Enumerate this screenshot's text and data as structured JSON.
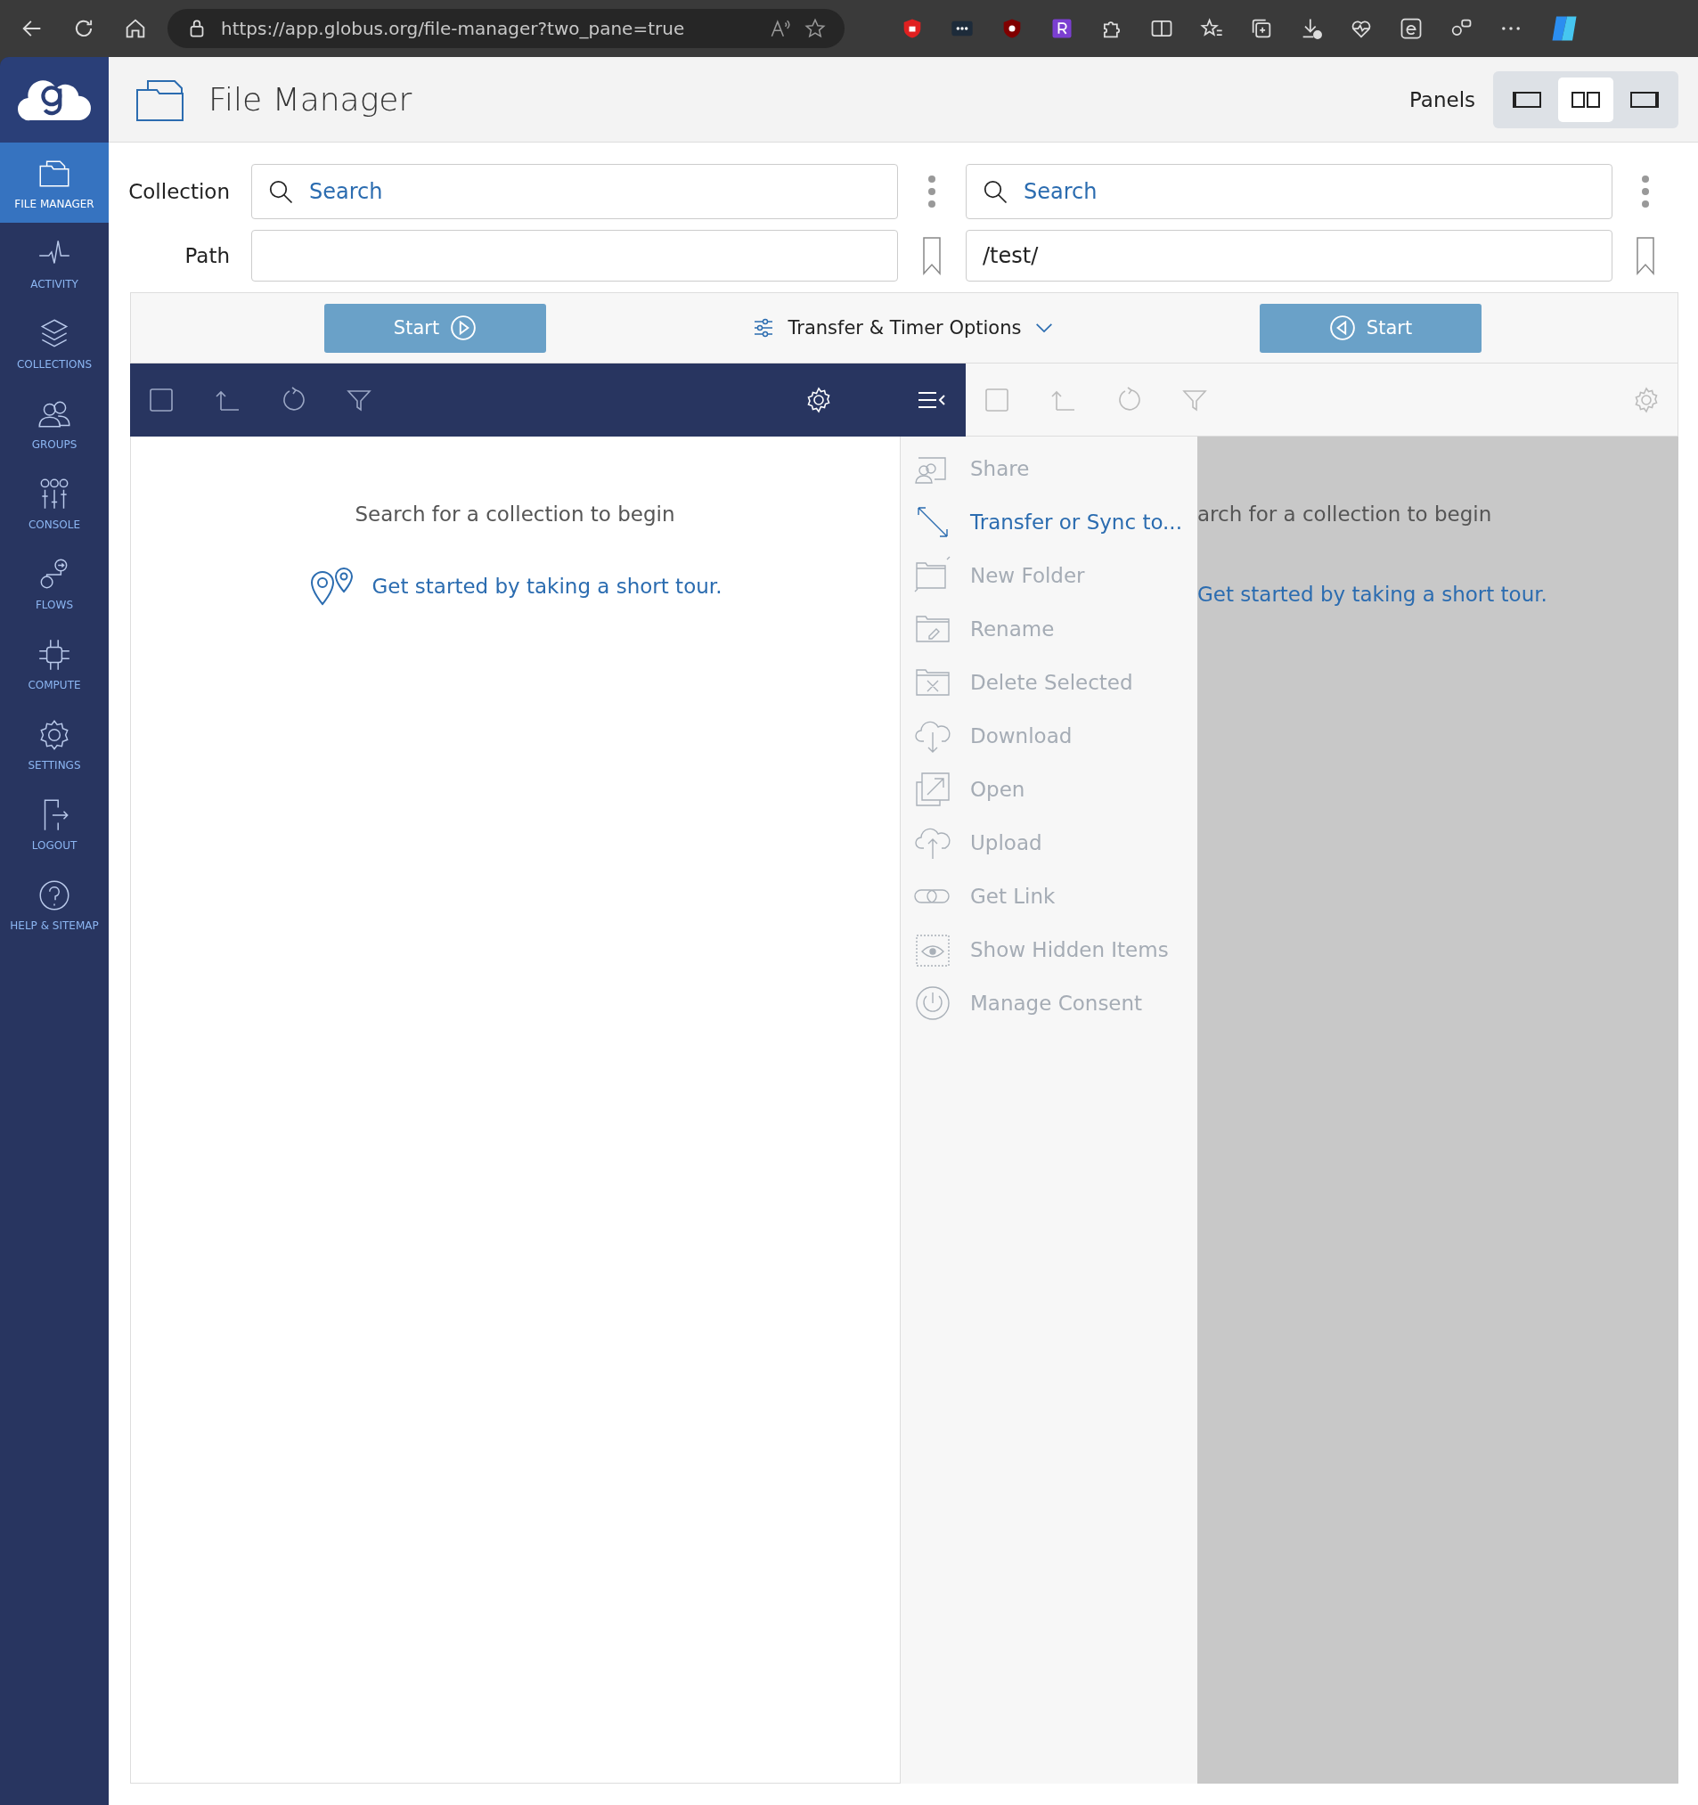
{
  "browser": {
    "url": "https://app.globus.org/file-manager?two_pane=true"
  },
  "sidebar": {
    "items": [
      {
        "label": "FILE MANAGER",
        "kind": "files",
        "selected": true
      },
      {
        "label": "ACTIVITY",
        "kind": "activity",
        "selected": false
      },
      {
        "label": "COLLECTIONS",
        "kind": "layers",
        "selected": false
      },
      {
        "label": "GROUPS",
        "kind": "people",
        "selected": false
      },
      {
        "label": "CONSOLE",
        "kind": "sliders",
        "selected": false
      },
      {
        "label": "FLOWS",
        "kind": "flow",
        "selected": false
      },
      {
        "label": "COMPUTE",
        "kind": "chip",
        "selected": false
      },
      {
        "label": "SETTINGS",
        "kind": "gear",
        "selected": false
      },
      {
        "label": "LOGOUT",
        "kind": "logout",
        "selected": false
      },
      {
        "label": "HELP & SITEMAP",
        "kind": "help",
        "selected": false
      }
    ]
  },
  "header": {
    "title": "File Manager",
    "panels_label": "Panels",
    "panel_options": [
      {
        "kind": "left",
        "selected": false
      },
      {
        "kind": "both",
        "selected": true
      },
      {
        "kind": "right",
        "selected": false
      }
    ]
  },
  "form": {
    "collection_label": "Collection",
    "path_label": "Path",
    "left": {
      "search_placeholder": "Search"
    },
    "right": {
      "search_placeholder": "Search",
      "path": "/test/"
    }
  },
  "transfer": {
    "start_left": "Start",
    "options": "Transfer & Timer Options",
    "start_right": "Start"
  },
  "left_pane": {
    "checkbox_checked": false,
    "message": "Search for a collection to begin",
    "tour_link": "Get started by taking a short tour."
  },
  "right_pane": {
    "checkbox_checked": false,
    "message": "arch for a collection to begin",
    "tour_link": "Get started by taking a short tour."
  },
  "menu": {
    "items": [
      {
        "label": "Share",
        "kind": "share",
        "disabled": true
      },
      {
        "label": "Transfer or Sync to...",
        "kind": "transfer",
        "disabled": false
      },
      {
        "label": "New Folder",
        "kind": "new-folder",
        "disabled": true
      },
      {
        "label": "Rename",
        "kind": "rename",
        "disabled": true
      },
      {
        "label": "Delete Selected",
        "kind": "delete",
        "disabled": true
      },
      {
        "label": "Download",
        "kind": "download",
        "disabled": true
      },
      {
        "label": "Open",
        "kind": "open",
        "disabled": true
      },
      {
        "label": "Upload",
        "kind": "upload",
        "disabled": true
      },
      {
        "label": "Get Link",
        "kind": "link",
        "disabled": true
      },
      {
        "label": "Show Hidden Items",
        "kind": "hidden",
        "disabled": true
      },
      {
        "label": "Manage Consent",
        "kind": "consent",
        "disabled": true
      }
    ]
  }
}
